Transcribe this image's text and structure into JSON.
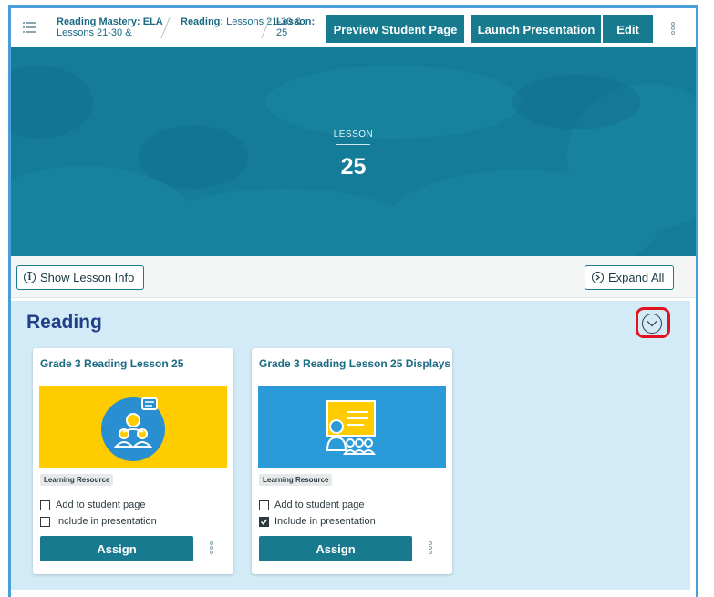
{
  "breadcrumbs": [
    {
      "strong": "Reading Mastery: ELA",
      "rest": "Lessons 21-30 &"
    },
    {
      "strong": "Reading:",
      "rest": " Lessons 21-30 &"
    },
    {
      "strong": "Lesson:",
      "rest": "25"
    }
  ],
  "toolbar": {
    "preview_label": "Preview Student Page",
    "launch_label": "Launch Presentation",
    "edit_label": "Edit"
  },
  "hero": {
    "kicker": "LESSON",
    "number": "25"
  },
  "infobar": {
    "show_info_label": "Show Lesson Info",
    "expand_all_label": "Expand All"
  },
  "section": {
    "title": "Reading"
  },
  "cards": [
    {
      "title": "Grade 3 Reading Lesson 25",
      "tag": "Learning Resource",
      "add_label": "Add to student page",
      "include_label": "Include in presentation",
      "add_checked": false,
      "include_checked": false,
      "assign_label": "Assign",
      "image_bg": "#ffcc00"
    },
    {
      "title": "Grade 3 Reading Lesson 25 Displays",
      "tag": "Learning Resource",
      "add_label": "Add to student page",
      "include_label": "Include in presentation",
      "add_checked": false,
      "include_checked": true,
      "assign_label": "Assign",
      "image_bg": "#2a9bd8"
    }
  ],
  "colors": {
    "accent": "#177a8e",
    "hero": "#147c99",
    "section_bg": "#d3ebf7",
    "title": "#223e86",
    "highlight_ring": "#e0131f"
  },
  "icons": [
    "list-menu-icon",
    "info-icon",
    "expand-chevron-icon",
    "collapse-chevron-icon",
    "kebab-menu-icon",
    "checkmark-icon"
  ]
}
